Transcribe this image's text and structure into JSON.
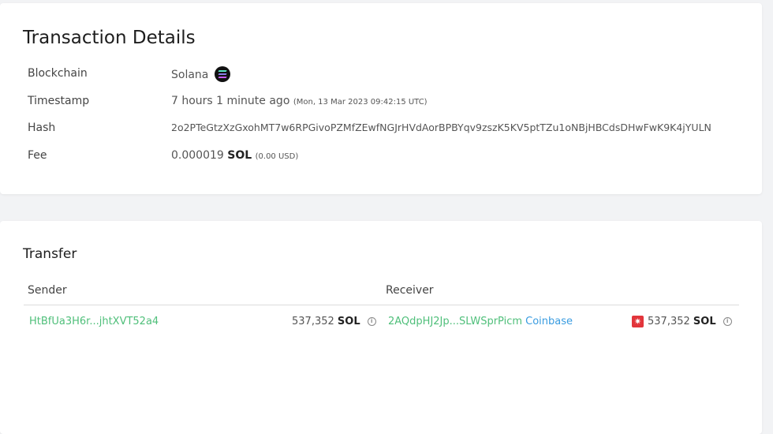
{
  "details": {
    "title": "Transaction Details",
    "blockchain_label": "Blockchain",
    "blockchain_value": "Solana",
    "blockchain_icon": "solana-logo-icon",
    "timestamp_label": "Timestamp",
    "timestamp_value": "7 hours 1 minute ago",
    "timestamp_exact": "(Mon, 13 Mar 2023 09:42:15 UTC)",
    "hash_label": "Hash",
    "hash_value": "2o2PTeGtzXzGxohMT7w6RPGivoPZMfZEwfNGJrHVdAorBPBYqv9zszK5KV5ptTZu1oNBjHBCdsDHwFwK9K4jYULN",
    "fee_label": "Fee",
    "fee_amount": "0.000019",
    "fee_unit": "SOL",
    "fee_usd": "(0.00 USD)"
  },
  "transfer": {
    "title": "Transfer",
    "sender_header": "Sender",
    "receiver_header": "Receiver",
    "rows": [
      {
        "sender": "HtBfUa3H6r...jhtXVT52a4",
        "sender_amount": "537,352",
        "sender_unit": "SOL",
        "receiver": "2AQdpHJ2Jp...SLWSprPicm",
        "receiver_tag": "Coinbase",
        "receiver_amount": "537,352",
        "receiver_unit": "SOL"
      }
    ]
  },
  "colors": {
    "link_green": "#4fbf7a",
    "tag_blue": "#3a9ce0",
    "alert_red": "#e2353b"
  }
}
